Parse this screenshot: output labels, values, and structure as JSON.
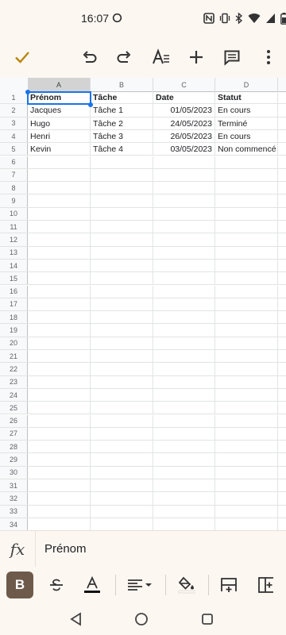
{
  "status_bar": {
    "time": "16:07",
    "icons": [
      "nfc-icon",
      "vibrate-icon",
      "bluetooth-icon",
      "wifi-icon",
      "signal-icon",
      "battery-icon"
    ]
  },
  "toolbar": {
    "buttons": [
      "check-icon",
      "undo-icon",
      "redo-icon",
      "text-format-icon",
      "add-icon",
      "comment-icon",
      "more-icon"
    ]
  },
  "sheet": {
    "columns": [
      "A",
      "B",
      "C",
      "D"
    ],
    "selected_column": "A",
    "selected_cell": "A1",
    "row_count": 34,
    "rows": [
      [
        "Prénom",
        "Tâche",
        "Date",
        "Statut"
      ],
      [
        "Jacques",
        "Tâche 1",
        "01/05/2023",
        "En cours"
      ],
      [
        "Hugo",
        "Tâche 2",
        "24/05/2023",
        "Terminé"
      ],
      [
        "Henri",
        "Tâche 3",
        "26/05/2023",
        "En cours"
      ],
      [
        "Kevin",
        "Tâche 4",
        "03/05/2023",
        "Non commencé"
      ]
    ]
  },
  "formula_bar": {
    "fx_label": "fx",
    "value": "Prénom"
  },
  "format_bar": {
    "bold_label": "B",
    "buttons": [
      "strikethrough-icon",
      "text-color-icon",
      "align-icon",
      "fill-color-icon",
      "insert-row-icon",
      "insert-column-icon"
    ]
  },
  "colors": {
    "accent": "#1a73e8",
    "chrome": "#fdf7f2",
    "bold_active": "#6e5a4b",
    "check": "#b8860b"
  }
}
